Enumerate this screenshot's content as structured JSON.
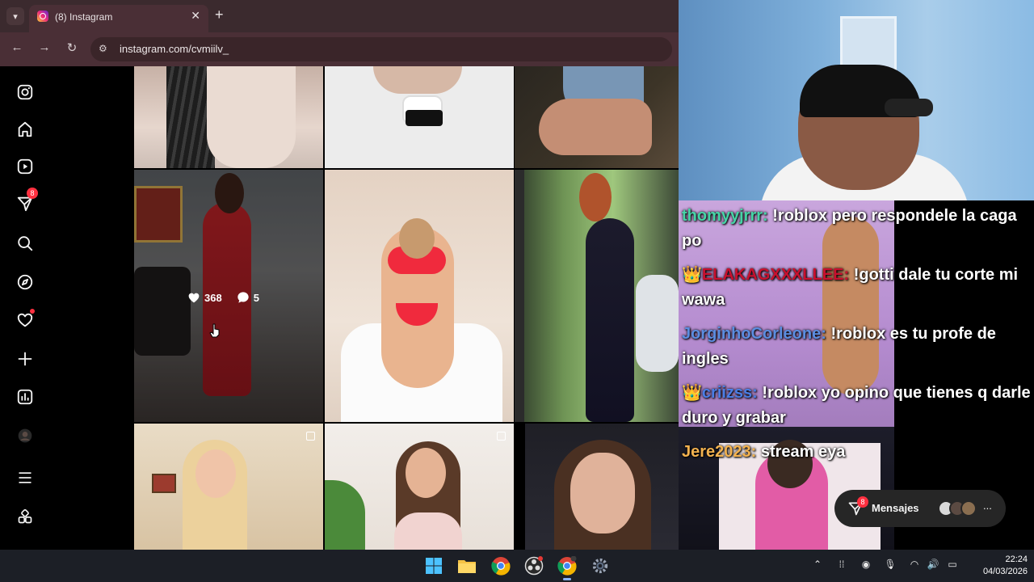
{
  "browser": {
    "tab_title": "(8) Instagram",
    "url": "instagram.com/cvmiilv_"
  },
  "sidebar": {
    "items": [
      {
        "name": "instagram-logo-icon"
      },
      {
        "name": "home-icon"
      },
      {
        "name": "reels-icon"
      },
      {
        "name": "messages-icon",
        "badge": "8"
      },
      {
        "name": "search-icon"
      },
      {
        "name": "explore-icon"
      },
      {
        "name": "notifications-icon"
      },
      {
        "name": "create-icon"
      },
      {
        "name": "dashboard-icon"
      },
      {
        "name": "profile-avatar"
      },
      {
        "name": "more-menu-icon"
      },
      {
        "name": "threads-apps-icon"
      }
    ]
  },
  "posts": {
    "hover": {
      "likes": "368",
      "comments": "5"
    }
  },
  "chat": {
    "messages": [
      {
        "user": "thomyyjrrr:",
        "text": " !roblox pero respondele la caga po",
        "color": "#46d3a6"
      },
      {
        "user": "ELAKAGXXXLLEE:",
        "text": " !gotti dale tu corte mi wawa",
        "color": "#c8102e",
        "badge": "👑"
      },
      {
        "user": "JorginhoCorleone:",
        "text": " !roblox es tu profe de ingles",
        "color": "#5b8de0"
      },
      {
        "user": "criizss:",
        "text": " !roblox yo opino que tienes q darle duro y grabar",
        "color": "#4a7ee6",
        "badge": "👑"
      },
      {
        "user": "Jere2023:",
        "text": " stream eya",
        "color": "#f3b24f"
      }
    ]
  },
  "messages_pill": {
    "label": "Mensajes",
    "badge": "8",
    "more": "..."
  },
  "taskbar": {
    "time": "22:24",
    "date": "04/03/2026"
  }
}
